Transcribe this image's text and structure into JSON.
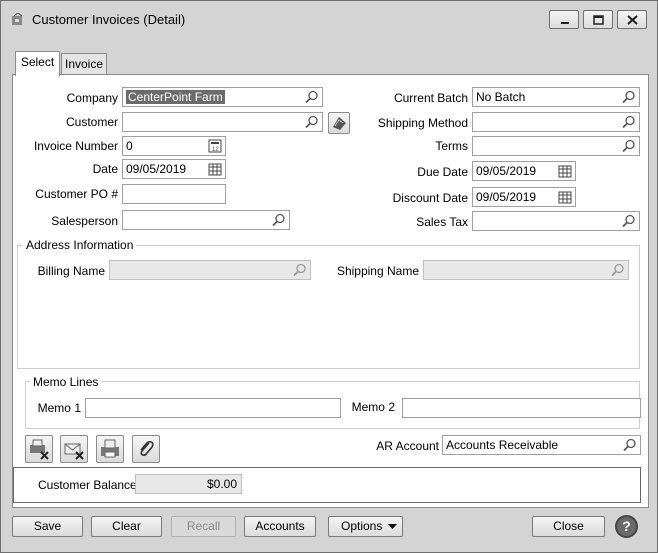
{
  "window": {
    "title": "Customer Invoices (Detail)"
  },
  "tabs": [
    {
      "label": "Select"
    },
    {
      "label": "Invoice"
    }
  ],
  "left": {
    "company": {
      "label": "Company",
      "value": "CenterPoint Farm"
    },
    "customer": {
      "label": "Customer",
      "value": ""
    },
    "invoice_number": {
      "label": "Invoice Number",
      "value": "0"
    },
    "date": {
      "label": "Date",
      "value": "09/05/2019"
    },
    "customer_po": {
      "label": "Customer PO #",
      "value": ""
    },
    "salesperson": {
      "label": "Salesperson",
      "value": ""
    }
  },
  "right": {
    "current_batch": {
      "label": "Current Batch",
      "value": "No Batch"
    },
    "shipping_method": {
      "label": "Shipping Method",
      "value": ""
    },
    "terms": {
      "label": "Terms",
      "value": ""
    },
    "due_date": {
      "label": "Due Date",
      "value": "09/05/2019"
    },
    "discount_date": {
      "label": "Discount Date",
      "value": "09/05/2019"
    },
    "sales_tax": {
      "label": "Sales Tax",
      "value": ""
    }
  },
  "address": {
    "title": "Address Information",
    "billing_name": {
      "label": "Billing Name",
      "value": ""
    },
    "shipping_name": {
      "label": "Shipping Name",
      "value": ""
    }
  },
  "memo": {
    "title": "Memo Lines",
    "memo1": {
      "label": "Memo 1",
      "value": ""
    },
    "memo2": {
      "label": "Memo 2",
      "value": ""
    }
  },
  "ar_account": {
    "label": "AR Account",
    "value": "Accounts Receivable"
  },
  "balance": {
    "label": "Customer Balance",
    "value": "$0.00"
  },
  "buttons": {
    "save": "Save",
    "clear": "Clear",
    "recall": "Recall",
    "accounts": "Accounts",
    "options": "Options",
    "close": "Close",
    "help": "?"
  },
  "icons": {
    "lookup": "magnifier-icon",
    "calendar": "calendar-icon",
    "calculator": "calculator-icon"
  }
}
